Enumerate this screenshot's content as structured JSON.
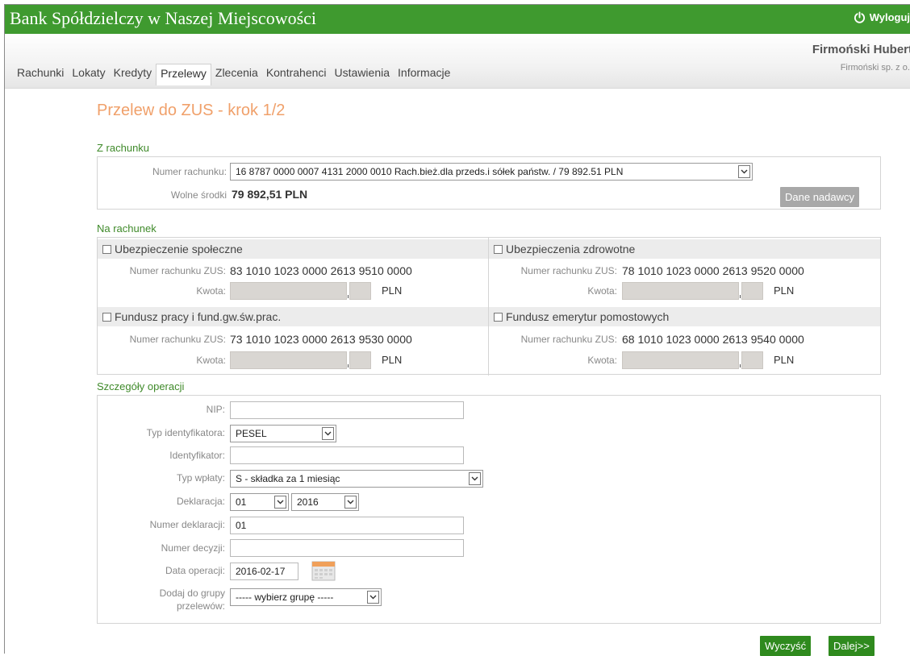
{
  "header": {
    "bank_name": "Bank Spółdzielczy w Naszej Miejscowości",
    "logout_label": "Wyloguj",
    "user_name": "Firmoński Hubert",
    "company": "Firmoński sp. z o.o"
  },
  "nav": [
    {
      "label": "Rachunki",
      "active": false
    },
    {
      "label": "Lokaty",
      "active": false
    },
    {
      "label": "Kredyty",
      "active": false
    },
    {
      "label": "Przelewy",
      "active": true
    },
    {
      "label": "Zlecenia",
      "active": false
    },
    {
      "label": "Kontrahenci",
      "active": false
    },
    {
      "label": "Ustawienia",
      "active": false
    },
    {
      "label": "Informacje",
      "active": false
    }
  ],
  "page": {
    "title": "Przelew do ZUS - krok 1/2"
  },
  "from_account": {
    "section_title": "Z rachunku",
    "account_label": "Numer rachunku:",
    "account_value": "16 8787 0000 0007 4131 2000 0010 Rach.bież.dla przeds.i sółek państw. / 79 892.51 PLN",
    "funds_label": "Wolne środki",
    "funds_value": "79 892,51 PLN",
    "sender_button": "Dane nadawcy"
  },
  "to_account": {
    "section_title": "Na rachunek",
    "account_label": "Numer rachunku ZUS:",
    "amount_label": "Kwota:",
    "currency": "PLN",
    "items": [
      {
        "title": "Ubezpieczenie społeczne",
        "account": "83 1010 1023 0000 2613 9510 0000"
      },
      {
        "title": "Ubezpieczenia zdrowotne",
        "account": "78 1010 1023 0000 2613 9520 0000"
      },
      {
        "title": "Fundusz pracy i fund.gw.św.prac.",
        "account": "73 1010 1023 0000 2613 9530 0000"
      },
      {
        "title": "Fundusz emerytur pomostowych",
        "account": "68 1010 1023 0000 2613 9540 0000"
      }
    ]
  },
  "details": {
    "section_title": "Szczegóły operacji",
    "nip_label": "NIP:",
    "nip_value": "",
    "id_type_label": "Typ identyfikatora:",
    "id_type_value": "PESEL",
    "identifier_label": "Identyfikator:",
    "identifier_value": "",
    "payment_type_label": "Typ wpłaty:",
    "payment_type_value": "S - składka za 1 miesiąc",
    "declaration_label": "Deklaracja:",
    "declaration_month": "01",
    "declaration_year": "2016",
    "declaration_number_label": "Numer deklaracji:",
    "declaration_number_value": "01",
    "decision_number_label": "Numer decyzji:",
    "decision_number_value": "",
    "date_label": "Data operacji:",
    "date_value": "2016-02-17",
    "group_label_line1": "Dodaj do grupy",
    "group_label_line2": "przelewów:",
    "group_value": "----- wybierz grupę -----"
  },
  "actions": {
    "clear_label": "Wyczyść",
    "next_label": "Dalej>>"
  },
  "colors": {
    "brand_green": "#3f9a2f",
    "title_orange": "#f0a06a",
    "button_green": "#2f8a1e"
  }
}
